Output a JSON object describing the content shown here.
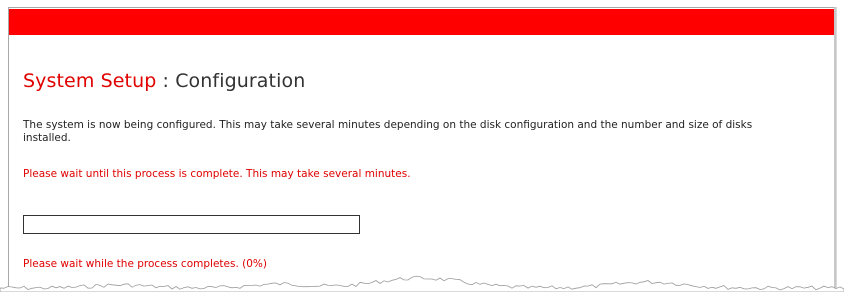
{
  "header": {
    "band_color": "#ff0000"
  },
  "title": {
    "primary": "System Setup",
    "separator": " : ",
    "secondary": "Configuration"
  },
  "description": "The system is now being configured. This may take several minutes depending on the disk configuration and the number and size of disks installed.",
  "notice": "Please wait until this process is complete. This may take several minutes.",
  "progress": {
    "percent": 0,
    "status_text": "Please wait while the process completes. (0%)"
  },
  "colors": {
    "accent": "#e00000",
    "text": "#222222",
    "border": "#333333"
  }
}
